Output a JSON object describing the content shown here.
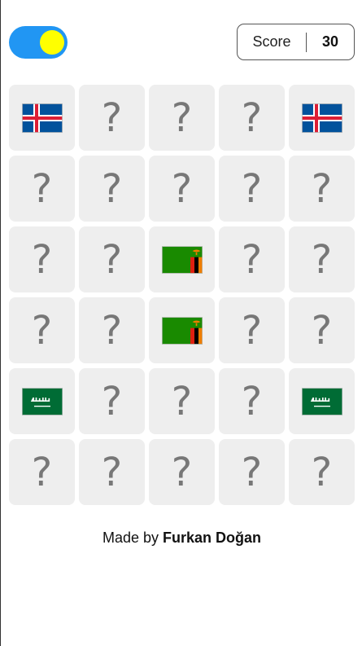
{
  "header": {
    "theme_toggle": {
      "state": "on",
      "track_color": "#2196f3",
      "knob_color": "#ffff00"
    },
    "score": {
      "label": "Score",
      "value": "30"
    }
  },
  "grid": {
    "columns": 5,
    "cards": [
      {
        "state": "revealed",
        "flag": "iceland"
      },
      {
        "state": "hidden",
        "symbol": "?"
      },
      {
        "state": "hidden",
        "symbol": "?"
      },
      {
        "state": "hidden",
        "symbol": "?"
      },
      {
        "state": "revealed",
        "flag": "iceland"
      },
      {
        "state": "hidden",
        "symbol": "?"
      },
      {
        "state": "hidden",
        "symbol": "?"
      },
      {
        "state": "hidden",
        "symbol": "?"
      },
      {
        "state": "hidden",
        "symbol": "?"
      },
      {
        "state": "hidden",
        "symbol": "?"
      },
      {
        "state": "hidden",
        "symbol": "?"
      },
      {
        "state": "hidden",
        "symbol": "?"
      },
      {
        "state": "revealed",
        "flag": "zambia"
      },
      {
        "state": "hidden",
        "symbol": "?"
      },
      {
        "state": "hidden",
        "symbol": "?"
      },
      {
        "state": "hidden",
        "symbol": "?"
      },
      {
        "state": "hidden",
        "symbol": "?"
      },
      {
        "state": "revealed",
        "flag": "zambia"
      },
      {
        "state": "hidden",
        "symbol": "?"
      },
      {
        "state": "hidden",
        "symbol": "?"
      },
      {
        "state": "revealed",
        "flag": "saudi-arabia"
      },
      {
        "state": "hidden",
        "symbol": "?"
      },
      {
        "state": "hidden",
        "symbol": "?"
      },
      {
        "state": "hidden",
        "symbol": "?"
      },
      {
        "state": "revealed",
        "flag": "saudi-arabia"
      },
      {
        "state": "hidden",
        "symbol": "?"
      },
      {
        "state": "hidden",
        "symbol": "?"
      },
      {
        "state": "hidden",
        "symbol": "?"
      },
      {
        "state": "hidden",
        "symbol": "?"
      },
      {
        "state": "hidden",
        "symbol": "?"
      }
    ]
  },
  "footer": {
    "prefix": "Made by ",
    "author": "Furkan Doğan"
  },
  "colors": {
    "card_bg": "#eeeeee",
    "question_mark": "#777777",
    "iceland_blue": "#02529c",
    "iceland_red": "#dc1e35",
    "zambia_green": "#198a00",
    "zambia_red": "#de2010",
    "zambia_orange": "#ef7d00",
    "saudi_green": "#006c35"
  }
}
